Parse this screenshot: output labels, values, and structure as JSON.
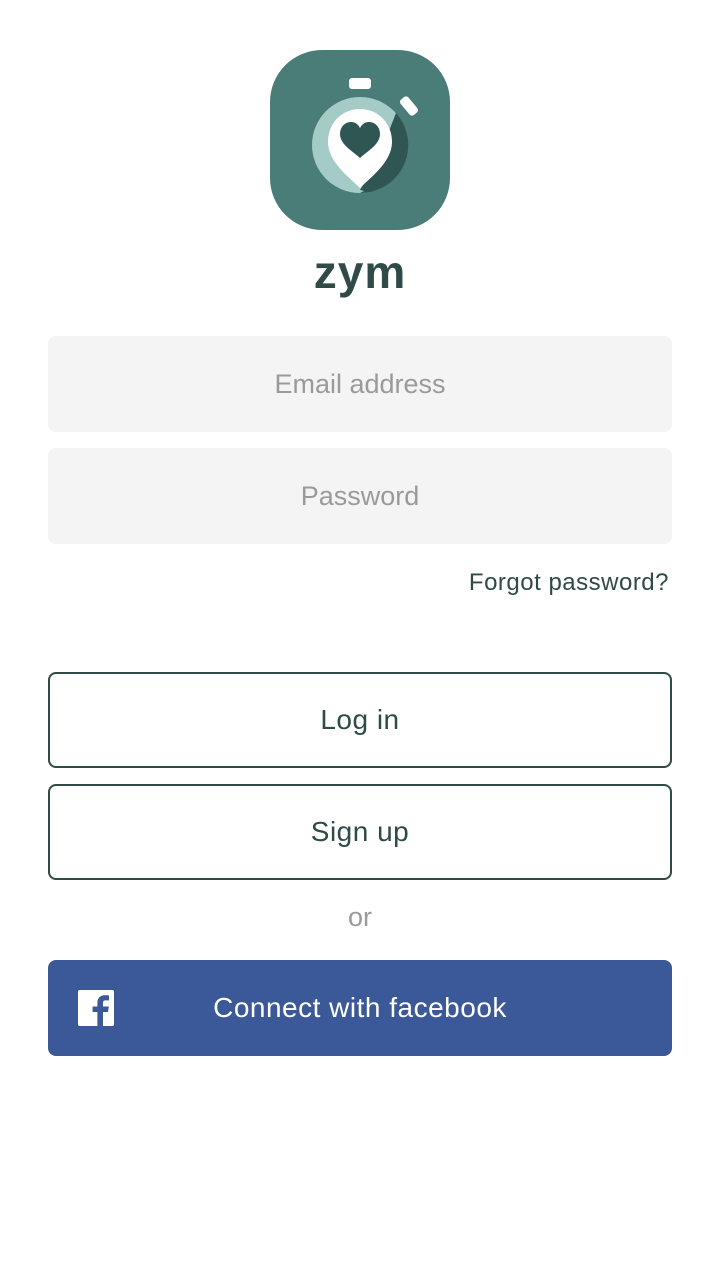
{
  "brand": {
    "name": "zym",
    "icon": "stopwatch-heart-pin-icon",
    "color": "#4a7d77"
  },
  "form": {
    "email_placeholder": "Email address",
    "email_value": "",
    "password_placeholder": "Password",
    "password_value": "",
    "forgot_password_label": "Forgot password?"
  },
  "actions": {
    "login_label": "Log in",
    "signup_label": "Sign up",
    "or_label": "or",
    "facebook_label": "Connect with facebook",
    "facebook_icon": "facebook-icon",
    "facebook_color": "#3b5998"
  },
  "colors": {
    "text_dark": "#2f4a47",
    "placeholder": "#9a9a9a",
    "field_background": "#f4f4f4"
  }
}
